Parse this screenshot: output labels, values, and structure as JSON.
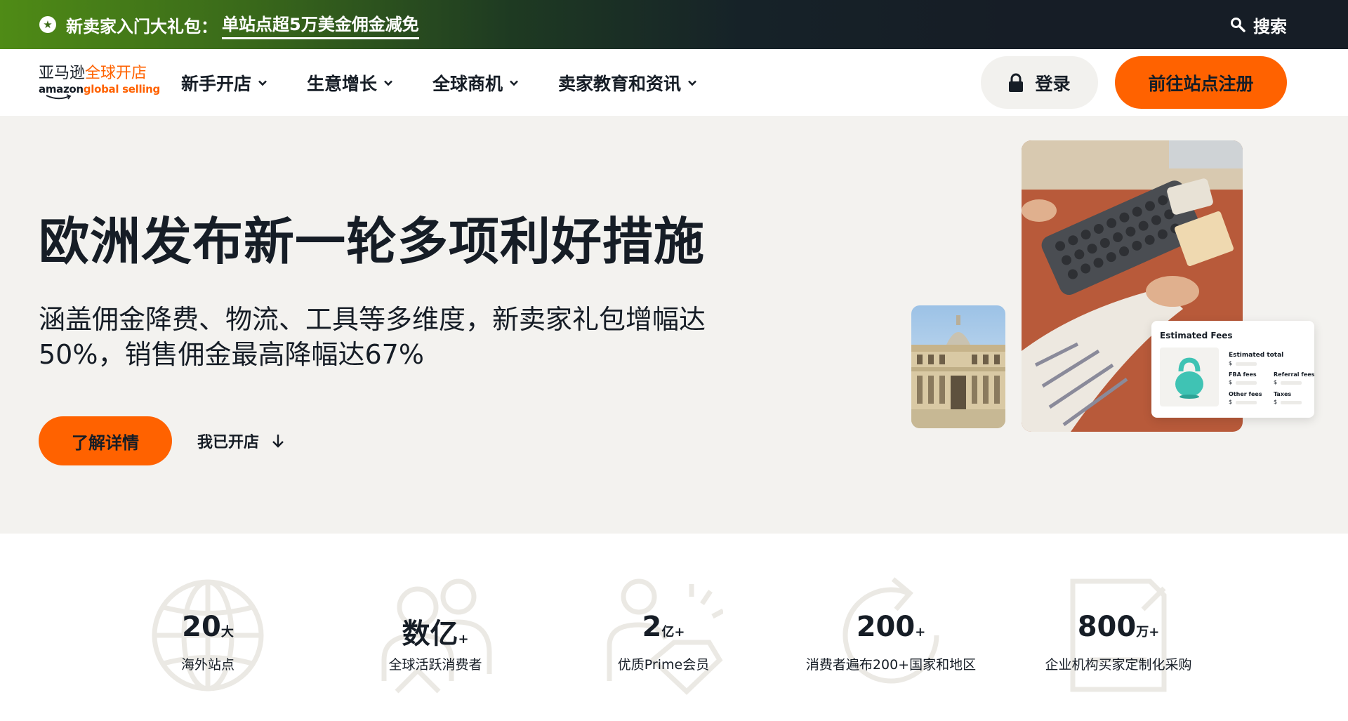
{
  "promo": {
    "prefix": "新卖家入门大礼包：",
    "link_text": "单站点超5万美金佣金减免",
    "search_label": "搜索"
  },
  "logo": {
    "cn_part1": "亚马逊",
    "cn_part2": "全球开店",
    "en_part1": "amazon",
    "en_part2": "global selling"
  },
  "nav": {
    "items": [
      {
        "label": "新手开店"
      },
      {
        "label": "生意增长"
      },
      {
        "label": "全球商机"
      },
      {
        "label": "卖家教育和资讯"
      }
    ],
    "login_label": "登录",
    "register_label": "前往站点注册"
  },
  "hero": {
    "title": "欧洲发布新一轮多项利好措施",
    "subtitle": "涵盖佣金降费、物流、工具等多维度，新卖家礼包增幅达50%，销售佣金最高降幅达67%",
    "cta_label": "了解详情",
    "secondary_label": "我已开店"
  },
  "fees_card": {
    "title": "Estimated Fees",
    "estimated_total": "Estimated total",
    "fba_fees": "FBA fees",
    "referral_fees": "Referral fees",
    "other_fees": "Other fees",
    "taxes": "Taxes",
    "currency": "$"
  },
  "stats": [
    {
      "value": "20",
      "unit": "大",
      "label": "海外站点",
      "icon": "globe-icon"
    },
    {
      "value": "数亿",
      "unit": "+",
      "label": "全球活跃消费者",
      "icon": "people-icon"
    },
    {
      "value": "2",
      "unit": "亿+",
      "label": "优质Prime会员",
      "icon": "prime-member-icon"
    },
    {
      "value": "200",
      "unit": "+",
      "label": "消费者遍布200+国家和地区",
      "icon": "refresh-icon"
    },
    {
      "value": "800",
      "unit": "万+",
      "label": "企业机构买家定制化采购",
      "icon": "document-icon"
    }
  ],
  "colors": {
    "accent": "#ff6200",
    "dark": "#161d26",
    "hero_bg": "#f3f2ef",
    "promo_green": "#4f8b16"
  }
}
